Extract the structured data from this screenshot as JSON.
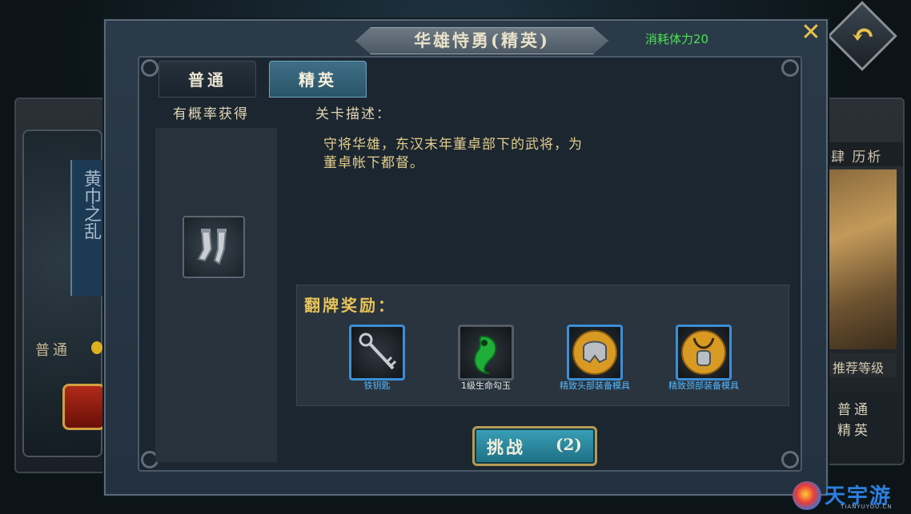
{
  "dialog": {
    "title": "华雄恃勇(精英)",
    "stamina_cost": "消耗体力20",
    "tabs": [
      {
        "label": "普通",
        "active": false
      },
      {
        "label": "精英",
        "active": true
      }
    ],
    "drops_label": "有概率获得",
    "drops": [
      {
        "icon": "iron-greaves-icon"
      }
    ],
    "description_label": "关卡描述：",
    "description": "守将华雄，东汉末年董卓部下的武将，为董卓帐下都督。",
    "rewards_label": "翻牌奖励：",
    "rewards": [
      {
        "name": "铁钥匙",
        "icon": "iron-key-icon",
        "name_color": "#55b8ff"
      },
      {
        "name": "1级生命勾玉",
        "icon": "green-magatama-icon",
        "name_color": "#e6e6e6"
      },
      {
        "name": "精致头部装备模具",
        "icon": "helmet-mold-icon",
        "name_color": "#55b8ff"
      },
      {
        "name": "精致颈部装备模具",
        "icon": "neck-mold-icon",
        "name_color": "#55b8ff"
      }
    ],
    "challenge": {
      "label": "挑战",
      "count": "(2)"
    }
  },
  "background": {
    "left_card": {
      "title": "黄巾之乱",
      "mode": "普通"
    },
    "right_card": {
      "header": "肆 历析",
      "recommend": "推荐等级",
      "modes": [
        "普通",
        "精英"
      ]
    }
  },
  "watermark": {
    "text": "天宇游",
    "sub": "TIANYUYOU.CN"
  },
  "colors": {
    "accent_gold": "#e8c45a",
    "stamina_green": "#4ee056",
    "reward_blue": "#55b8ff",
    "active_tab": "#3f6f86"
  }
}
